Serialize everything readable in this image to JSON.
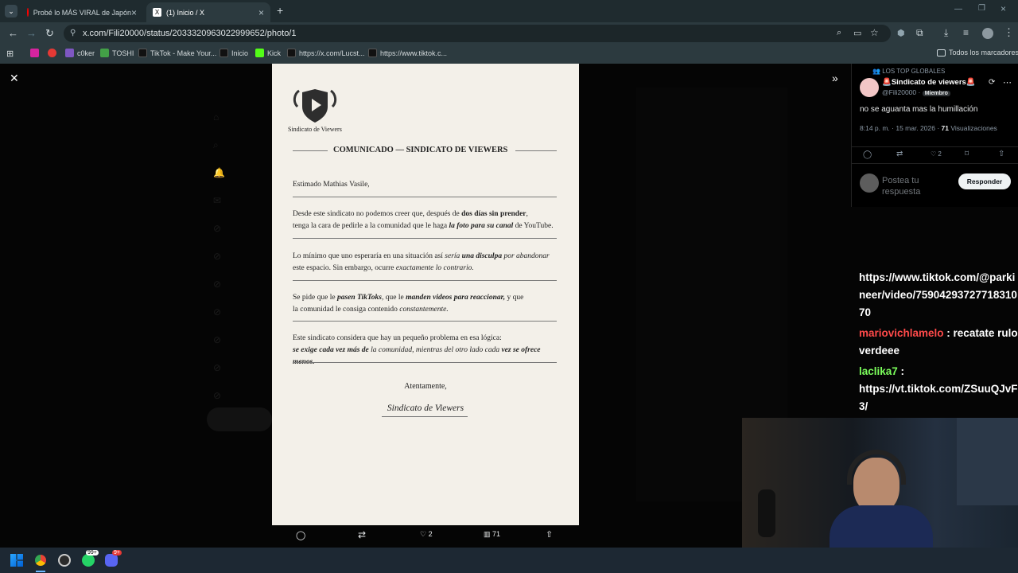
{
  "browser": {
    "tabs": [
      {
        "title": "Probé lo MÁS VIRAL de Japón"
      },
      {
        "title": "(1) Inicio / X"
      }
    ],
    "url": "x.com/Fili20000/status/2033320963022999652/photo/1",
    "bookmarks": [
      "c0ker",
      "TOSHI",
      "TikTok - Make Your...",
      "Inicio",
      "Kick",
      "https://x.com/Lucst...",
      "https://www.tiktok.c..."
    ],
    "all_bookmarks": "Todos los marcadores"
  },
  "letter": {
    "logo_text": "Sindicato de Viewers",
    "heading": "COMUNICADO — SINDICATO DE VIEWERS",
    "greeting": "Estimado Mathias Vasile,",
    "p1a": "Desde este sindicato no podemos creer que, después de ",
    "p1b": "dos días sin prender",
    "p1c": ",",
    "p1d": "tenga la cara de pedirle a la comunidad que le haga ",
    "p1e": "la foto para su canal",
    "p1f": " de YouTube.",
    "p2a": "Lo mínimo que uno esperaría en una situación así ",
    "p2b": "sería ",
    "p2c": "una disculpa",
    "p2d": " por ",
    "p2e": "abandonar",
    "p2f": "este espacio. Sin embargo, ocurre ",
    "p2g": "exactamente lo contrario.",
    "p3a": "Se pide que le ",
    "p3b": "pasen TikToks",
    ",p3c": "",
    "p3c2": ", que le ",
    "p3d": "manden videos para reaccionar,",
    "p3e": " y que",
    "p3f": "la comunidad le consiga contenido ",
    "p3g": "constantemente.",
    "p4a": "Este sindicato considera que hay un pequeño problema en esa lógica:",
    "p4b": "se exige cada vez más de",
    "p4c": " la comunidad, mientras del otro lado cada ",
    "p4d": "vez se ofrece menos.",
    "closing": "Atentamente,",
    "signature": "Sindicato de Viewers"
  },
  "tweet": {
    "community": "LOS TOP GLOBALES",
    "name": "🚨Sindicato de viewers🚨",
    "handle": "@Fili20000 ·",
    "badge": "Miembro",
    "text": "no se aguanta mas la humillación",
    "time": "8:14 p. m. · 15 mar. 2026 · ",
    "views_count": "71",
    "views_label": " Visualizaciones",
    "likes": "2",
    "reply_placeholder": "Postea tu respuesta",
    "reply_button": "Responder"
  },
  "media_actions": {
    "likes": "2",
    "views": "71"
  },
  "chat": [
    {
      "user": "",
      "text": "https://www.tiktok.com/@parkineer/video/7590429372771831070"
    },
    {
      "user": "mariovichlamelo",
      "text": " : recatate rulo verdeee"
    },
    {
      "user": "laclika7",
      "text": " :"
    },
    {
      "user": "",
      "text": "https://vt.tiktok.com/ZSuuQJvF3/"
    }
  ],
  "taskbar": {
    "whatsapp_badge": "99+",
    "discord_badge": "9+"
  },
  "colors": {
    "letter_bg": "#f3f0e9",
    "chat_user1": "#ff4a4a",
    "chat_user2": "#7cff5c",
    "responder": "#eff3f4"
  }
}
